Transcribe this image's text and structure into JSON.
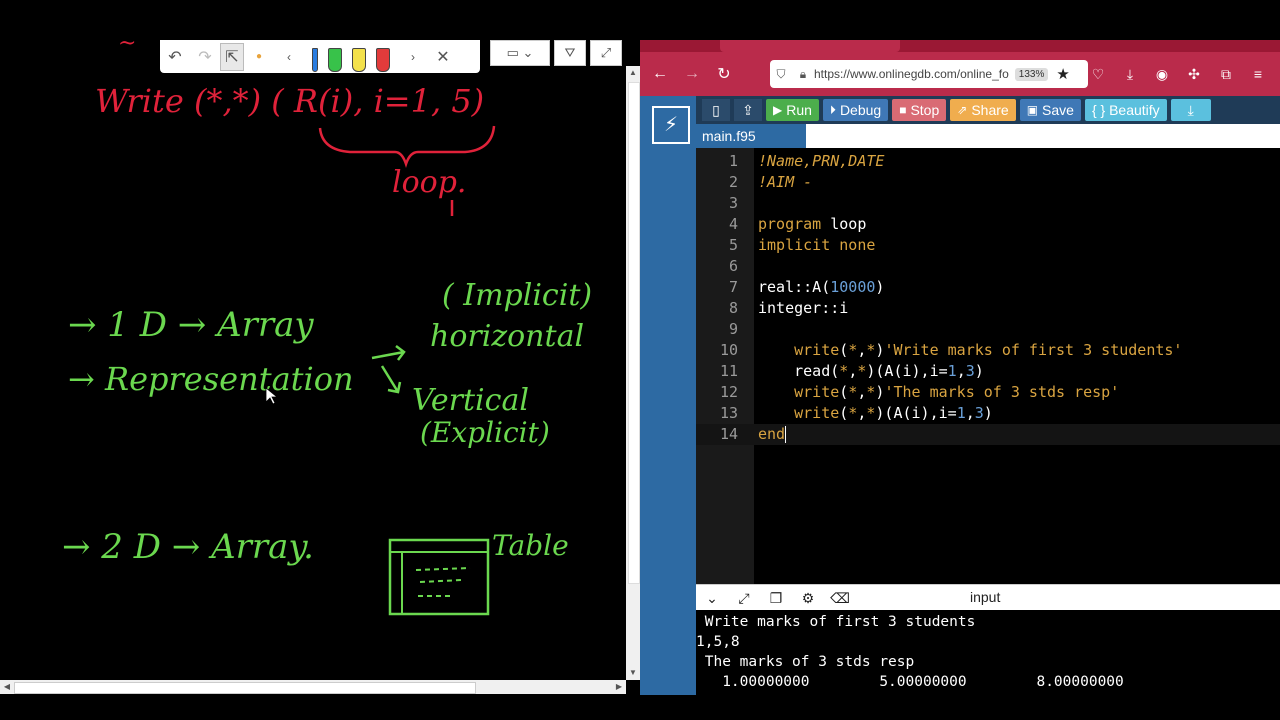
{
  "whiteboard": {
    "pen_colors": [
      "#e8a33c",
      "#2a7de1",
      "#38c24a",
      "#f3e14b",
      "#e23b3b"
    ],
    "ink": {
      "red": "#e0223a",
      "green": "#6bd84f"
    },
    "notes": {
      "write_stmt": "Write (*,*) ( R(i), i=1, 5)",
      "loop": "loop.",
      "one_d": "→ 1 D → Array",
      "implicit": "( Implicit)",
      "horizontal": "horizontal",
      "representation": "→ Representation",
      "vertical": "Vertical",
      "explicit": "(Explicit)",
      "two_d": "→ 2 D → Array.",
      "table": "Table"
    }
  },
  "browser": {
    "url": "https://www.onlinegdb.com/online_fo",
    "zoom": "133%",
    "accent": "#ba2b4b"
  },
  "gdb": {
    "toolbar": {
      "run": "Run",
      "debug": "Debug",
      "stop": "Stop",
      "share": "Share",
      "save": "Save",
      "beautify": "{ } Beautify"
    },
    "file_tab": "main.f95",
    "code": [
      {
        "n": "1",
        "parts": [
          {
            "t": "!Name,PRN,DATE",
            "c": "comment"
          }
        ]
      },
      {
        "n": "2",
        "parts": [
          {
            "t": "!AIM -",
            "c": "comment"
          }
        ]
      },
      {
        "n": "3",
        "parts": []
      },
      {
        "n": "4",
        "parts": [
          {
            "t": "program ",
            "c": "kw"
          },
          {
            "t": "loop",
            "c": "plain"
          }
        ]
      },
      {
        "n": "5",
        "parts": [
          {
            "t": "implicit none",
            "c": "kw"
          }
        ]
      },
      {
        "n": "6",
        "parts": []
      },
      {
        "n": "7",
        "parts": [
          {
            "t": "real::A(",
            "c": "plain"
          },
          {
            "t": "10000",
            "c": "num"
          },
          {
            "t": ")",
            "c": "plain"
          }
        ]
      },
      {
        "n": "8",
        "parts": [
          {
            "t": "integer::i",
            "c": "plain"
          }
        ]
      },
      {
        "n": "9",
        "parts": []
      },
      {
        "n": "10",
        "parts": [
          {
            "t": "    write",
            "c": "kw"
          },
          {
            "t": "(",
            "c": "plain"
          },
          {
            "t": "*",
            "c": "kw"
          },
          {
            "t": ",",
            "c": "plain"
          },
          {
            "t": "*",
            "c": "kw"
          },
          {
            "t": ")",
            "c": "plain"
          },
          {
            "t": "'Write marks of first 3 students'",
            "c": "str"
          }
        ]
      },
      {
        "n": "11",
        "parts": [
          {
            "t": "    read(",
            "c": "plain"
          },
          {
            "t": "*",
            "c": "kw"
          },
          {
            "t": ",",
            "c": "plain"
          },
          {
            "t": "*",
            "c": "kw"
          },
          {
            "t": ")(A(i),i=",
            "c": "plain"
          },
          {
            "t": "1",
            "c": "num"
          },
          {
            "t": ",",
            "c": "plain"
          },
          {
            "t": "3",
            "c": "num"
          },
          {
            "t": ")",
            "c": "plain"
          }
        ]
      },
      {
        "n": "12",
        "parts": [
          {
            "t": "    write",
            "c": "kw"
          },
          {
            "t": "(",
            "c": "plain"
          },
          {
            "t": "*",
            "c": "kw"
          },
          {
            "t": ",",
            "c": "plain"
          },
          {
            "t": "*",
            "c": "kw"
          },
          {
            "t": ")",
            "c": "plain"
          },
          {
            "t": "'The marks of 3 stds resp'",
            "c": "str"
          }
        ]
      },
      {
        "n": "13",
        "parts": [
          {
            "t": "    write",
            "c": "kw"
          },
          {
            "t": "(",
            "c": "plain"
          },
          {
            "t": "*",
            "c": "kw"
          },
          {
            "t": ",",
            "c": "plain"
          },
          {
            "t": "*",
            "c": "kw"
          },
          {
            "t": ")(A(i),i=",
            "c": "plain"
          },
          {
            "t": "1",
            "c": "num"
          },
          {
            "t": ",",
            "c": "plain"
          },
          {
            "t": "3",
            "c": "num"
          },
          {
            "t": ")",
            "c": "plain"
          }
        ]
      },
      {
        "n": "14",
        "parts": [
          {
            "t": "end",
            "c": "kw"
          }
        ],
        "cursor": true
      }
    ],
    "io_title": "input",
    "console": [
      " Write marks of first 3 students",
      "1,5,8",
      " The marks of 3 stds resp",
      "   1.00000000        5.00000000        8.00000000"
    ]
  }
}
